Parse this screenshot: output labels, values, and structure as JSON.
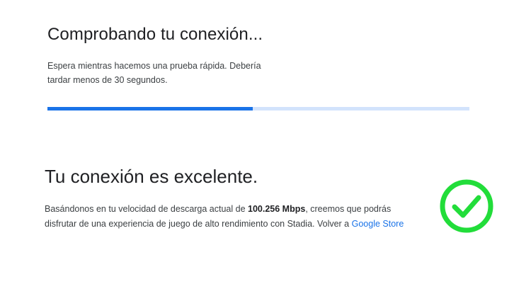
{
  "connection_check": {
    "title": "Comprobando tu conexión...",
    "description": "Espera mientras hacemos una prueba rápida. Debería tardar menos de 30 segundos.",
    "progress_fraction": 0.486
  },
  "result": {
    "title": "Tu conexión es excelente.",
    "description_prefix": "Basándonos en tu velocidad de descarga actual de ",
    "speed": "100.256 Mbps",
    "description_suffix": ", creemos que podrás disfrutar de una experiencia de juego de alto rendimiento con Stadia. Volver a ",
    "store_link_label": "Google Store",
    "status_icon": "check-circle-icon"
  },
  "colors": {
    "progress_fill": "#1a73e8",
    "progress_track": "#d2e3fc",
    "success": "#22dd3a",
    "link": "#1a73e8"
  }
}
